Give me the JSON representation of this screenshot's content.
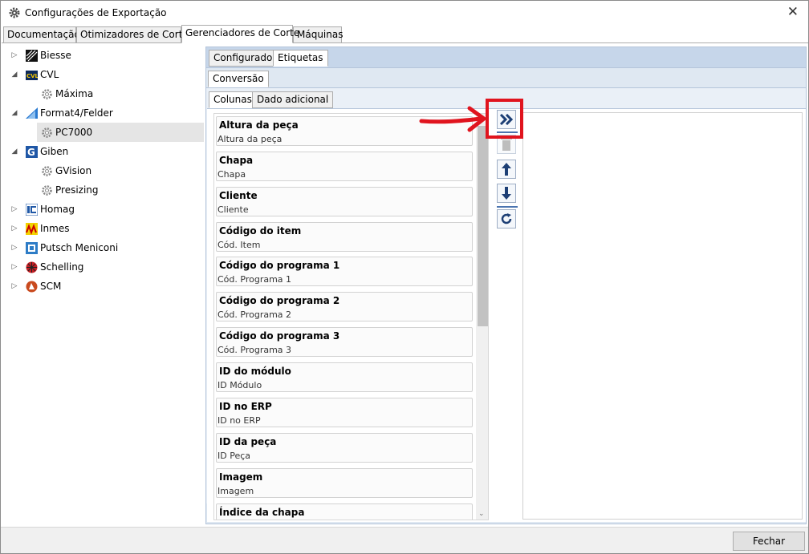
{
  "window": {
    "title": "Configurações de Exportação"
  },
  "tabs": [
    "Documentação",
    "Otimizadores de Corte",
    "Gerenciadores de Corte",
    "Máquinas"
  ],
  "tree": [
    {
      "label": "Biesse",
      "expanded": false
    },
    {
      "label": "CVL",
      "expanded": true
    },
    {
      "label": "Máxima"
    },
    {
      "label": "Format4/Felder",
      "expanded": true
    },
    {
      "label": "PC7000"
    },
    {
      "label": "Giben",
      "expanded": true
    },
    {
      "label": "GVision"
    },
    {
      "label": "Presizing"
    },
    {
      "label": "Homag"
    },
    {
      "label": "Inmes"
    },
    {
      "label": "Putsch Meniconi"
    },
    {
      "label": "Schelling"
    },
    {
      "label": "SCM"
    }
  ],
  "subtabs": [
    "Configurador",
    "Etiquetas"
  ],
  "subtab2": "Conversão",
  "subtabs3": [
    "Colunas",
    "Dado adicional"
  ],
  "columns": [
    {
      "title": "Altura da peça",
      "sub": "Altura da peça"
    },
    {
      "title": "Chapa",
      "sub": "Chapa"
    },
    {
      "title": "Cliente",
      "sub": "Cliente"
    },
    {
      "title": "Código do item",
      "sub": "Cód. Item"
    },
    {
      "title": "Código do programa 1",
      "sub": "Cód. Programa 1"
    },
    {
      "title": "Código do programa 2",
      "sub": "Cód. Programa 2"
    },
    {
      "title": "Código do programa 3",
      "sub": "Cód. Programa 3"
    },
    {
      "title": "ID do módulo",
      "sub": "ID Módulo"
    },
    {
      "title": "ID no ERP",
      "sub": "ID no ERP"
    },
    {
      "title": "ID da peça",
      "sub": "ID Peça"
    },
    {
      "title": "Imagem",
      "sub": "Imagem"
    },
    {
      "title": "Índice da chapa",
      "sub": ""
    }
  ],
  "footer": {
    "close_label": "Fechar"
  }
}
